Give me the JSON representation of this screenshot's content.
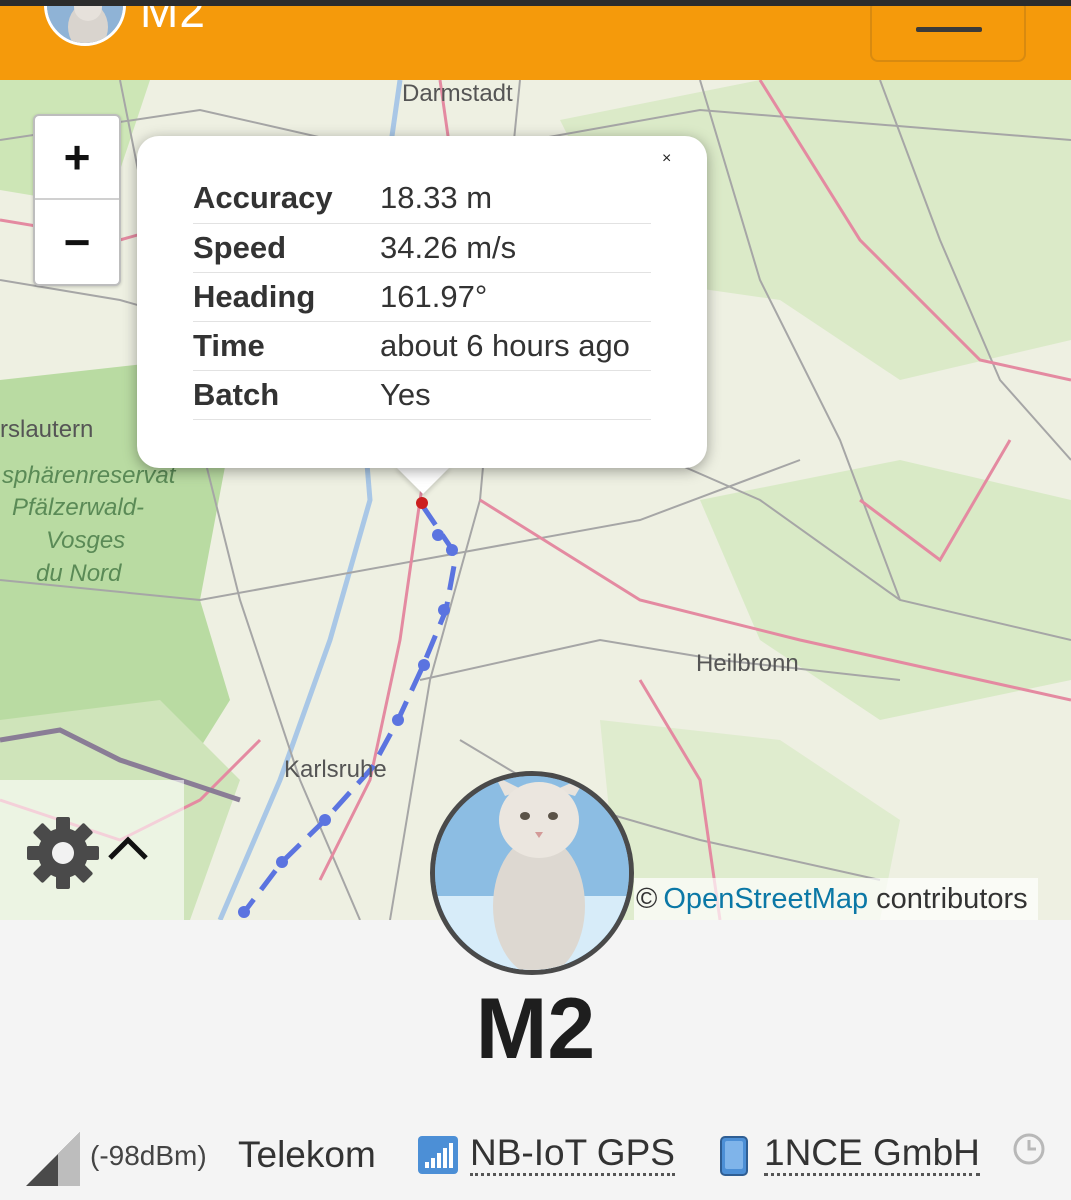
{
  "header": {
    "title": "M2",
    "menu_icon": "hamburger-icon",
    "bg_color": "#f59a0b"
  },
  "map": {
    "labels": {
      "darmstadt": "Darmstadt",
      "kaiserslautern": "rslautern",
      "biosphere_1": "sphärenreservat",
      "biosphere_2": "Pfälzerwald-",
      "biosphere_3": "Vosges",
      "biosphere_4": "du Nord",
      "heilbronn": "Heilbronn",
      "karlsruhe": "Karlsruhe"
    },
    "zoom_in": "+",
    "zoom_out": "−",
    "attribution_prefix": "©",
    "attribution_link": "OpenStreetMap",
    "attribution_suffix": "contributors",
    "track_color": "#5b74e0",
    "marker_color": "#cc1f1f"
  },
  "popup": {
    "close_label": "×",
    "rows": [
      {
        "key": "Accuracy",
        "value": "18.33 m"
      },
      {
        "key": "Speed",
        "value": "34.26 m/s"
      },
      {
        "key": "Heading",
        "value": "161.97°"
      },
      {
        "key": "Time",
        "value": "about 6 hours ago"
      },
      {
        "key": "Batch",
        "value": "Yes"
      }
    ]
  },
  "controls": {
    "settings_icon": "gear-icon",
    "expand_icon": "chevron-up-icon"
  },
  "device": {
    "name": "M2"
  },
  "status": {
    "signal_icon": "signal-strength-icon",
    "signal": "(-98dBm)",
    "operator": "Telekom",
    "network_icon": "network-bars-icon",
    "network": "NB-IoT GPS",
    "sim_icon": "sim-card-icon",
    "sim_provider": "1NCE GmbH",
    "clock_icon": "clock-icon"
  }
}
